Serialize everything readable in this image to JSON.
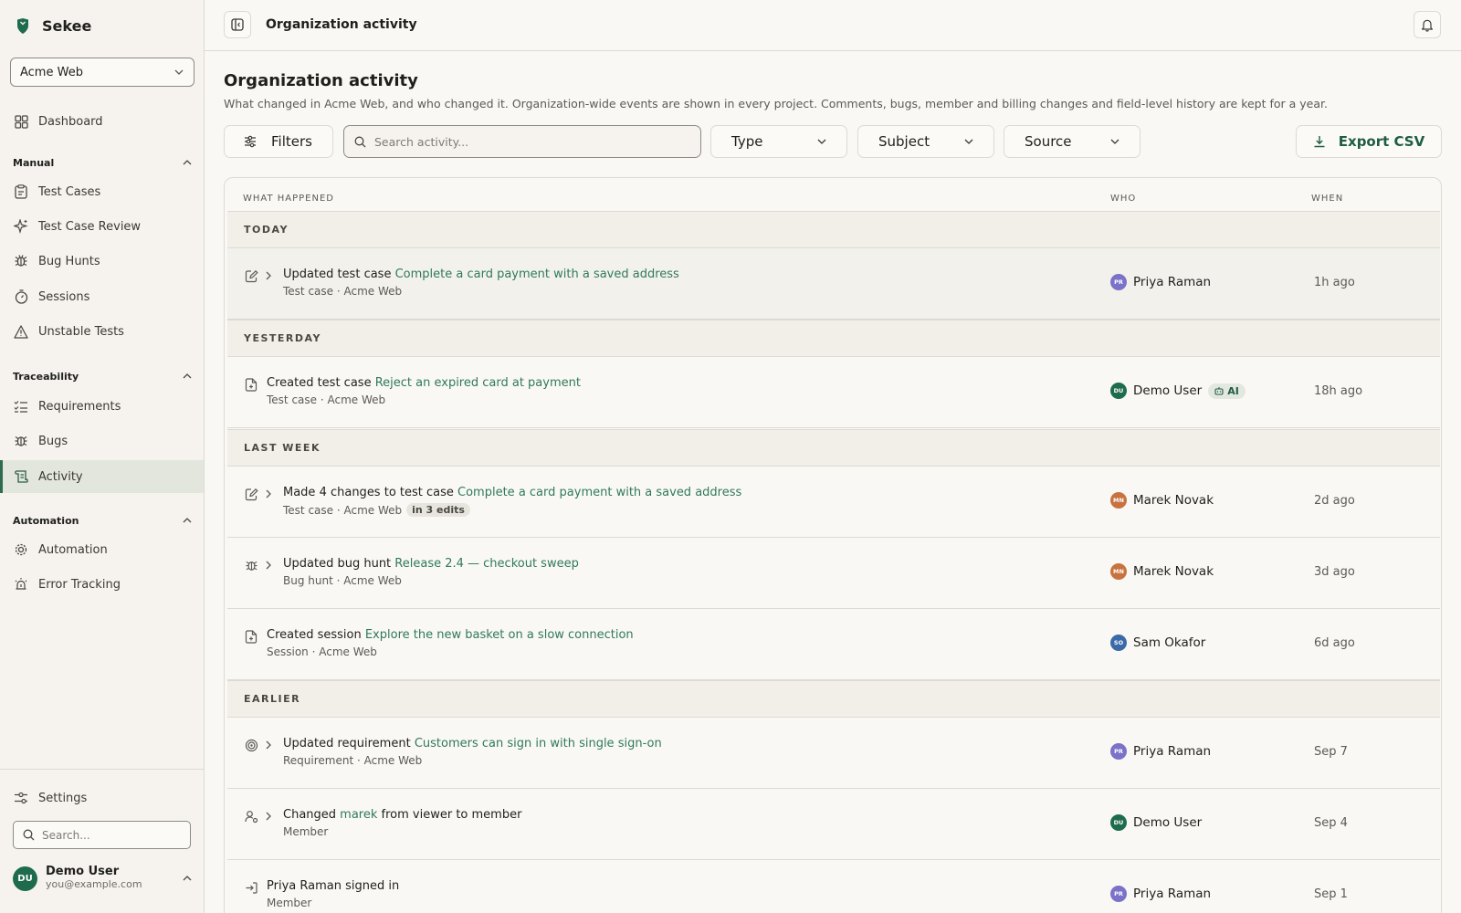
{
  "app": {
    "name": "Sekee"
  },
  "project_select": {
    "value": "Acme Web"
  },
  "nav": {
    "dashboard": "Dashboard",
    "manual_title": "Manual",
    "manual_items": [
      "Test Cases",
      "Test Case Review",
      "Bug Hunts",
      "Sessions",
      "Unstable Tests"
    ],
    "traceability_title": "Traceability",
    "traceability_items": [
      "Requirements",
      "Bugs",
      "Activity"
    ],
    "automation_title": "Automation",
    "automation_items": [
      "Automation",
      "Error Tracking"
    ],
    "settings": "Settings",
    "search_placeholder": "Search..."
  },
  "user": {
    "initials": "DU",
    "name": "Demo User",
    "email": "you@example.com"
  },
  "topbar": {
    "title": "Organization activity"
  },
  "page": {
    "title": "Organization activity",
    "description": "What changed in Acme Web, and who changed it. Organization-wide events are shown in every project. Comments, bugs, member and billing changes and field-level history are kept for a year."
  },
  "toolbar": {
    "filters_label": "Filters",
    "search_placeholder": "Search activity...",
    "type_label": "Type",
    "subject_label": "Subject",
    "source_label": "Source",
    "export_label": "Export CSV"
  },
  "table": {
    "headers": {
      "what": "WHAT HAPPENED",
      "who": "WHO",
      "when": "WHEN"
    },
    "groups": [
      "TODAY",
      "YESTERDAY",
      "LAST WEEK",
      "EARLIER"
    ],
    "rows": [
      {
        "action": "Updated test case",
        "subject": "Complete a card payment with a saved address",
        "suffix": "",
        "meta": "Test case · Acme Web",
        "badge": "",
        "who": "Priya Raman",
        "initials": "PR",
        "ai": "",
        "when": "1h ago"
      },
      {
        "action": "Created test case",
        "subject": "Reject an expired card at payment",
        "suffix": "",
        "meta": "Test case · Acme Web",
        "badge": "",
        "who": "Demo User",
        "initials": "DU",
        "ai": "AI",
        "when": "18h ago"
      },
      {
        "action": "Made 4 changes to test case",
        "subject": "Complete a card payment with a saved address",
        "suffix": "",
        "meta": "Test case · Acme Web",
        "badge": "in 3 edits",
        "who": "Marek Novak",
        "initials": "MN",
        "ai": "",
        "when": "2d ago"
      },
      {
        "action": "Updated bug hunt",
        "subject": "Release 2.4 — checkout sweep",
        "suffix": "",
        "meta": "Bug hunt · Acme Web",
        "badge": "",
        "who": "Marek Novak",
        "initials": "MN",
        "ai": "",
        "when": "3d ago"
      },
      {
        "action": "Created session",
        "subject": "Explore the new basket on a slow connection",
        "suffix": "",
        "meta": "Session · Acme Web",
        "badge": "",
        "who": "Sam Okafor",
        "initials": "SO",
        "ai": "",
        "when": "6d ago"
      },
      {
        "action": "Updated requirement",
        "subject": "Customers can sign in with single sign-on",
        "suffix": "",
        "meta": "Requirement · Acme Web",
        "badge": "",
        "who": "Priya Raman",
        "initials": "PR",
        "ai": "",
        "when": "Sep 7"
      },
      {
        "action": "Changed",
        "subject": "marek",
        "suffix": "from viewer to member",
        "meta": "Member",
        "badge": "",
        "who": "Demo User",
        "initials": "DU",
        "ai": "",
        "when": "Sep 4"
      },
      {
        "action": "Priya Raman signed in",
        "subject": "",
        "suffix": "",
        "meta": "Member",
        "badge": "",
        "who": "Priya Raman",
        "initials": "PR",
        "ai": "",
        "when": "Sep 1"
      }
    ]
  },
  "colors": {
    "accent": "#2f7a5a",
    "avatar_priya": "#7b72c9",
    "avatar_demo": "#1f6b4d",
    "avatar_marek": "#c8723f",
    "avatar_sam": "#3b6aa8"
  },
  "icons": {
    "brand": "shield-logo-icon",
    "bell": "bell-icon",
    "sidebar_toggle": "sidebar-toggle-icon",
    "filters": "sliders-icon",
    "search": "search-icon",
    "export": "download-icon"
  }
}
